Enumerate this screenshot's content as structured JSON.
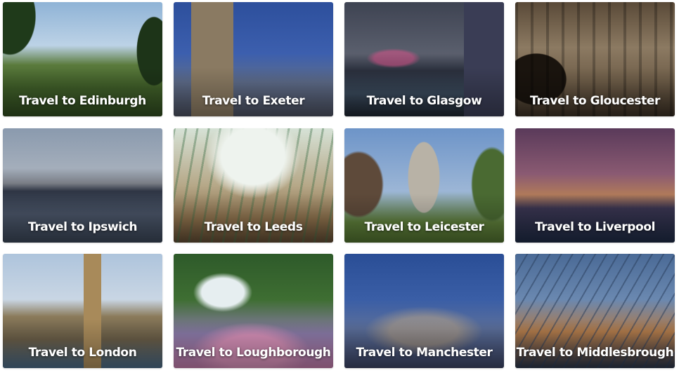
{
  "cards": [
    {
      "label": "Travel to Edinburgh"
    },
    {
      "label": "Travel to Exeter"
    },
    {
      "label": "Travel to Glasgow"
    },
    {
      "label": "Travel to Gloucester"
    },
    {
      "label": "Travel to Ipswich"
    },
    {
      "label": "Travel to Leeds"
    },
    {
      "label": "Travel to Leicester"
    },
    {
      "label": "Travel to Liverpool"
    },
    {
      "label": "Travel to London"
    },
    {
      "label": "Travel to Loughborough"
    },
    {
      "label": "Travel to Manchester"
    },
    {
      "label": "Travel to Middlesbrough"
    }
  ]
}
